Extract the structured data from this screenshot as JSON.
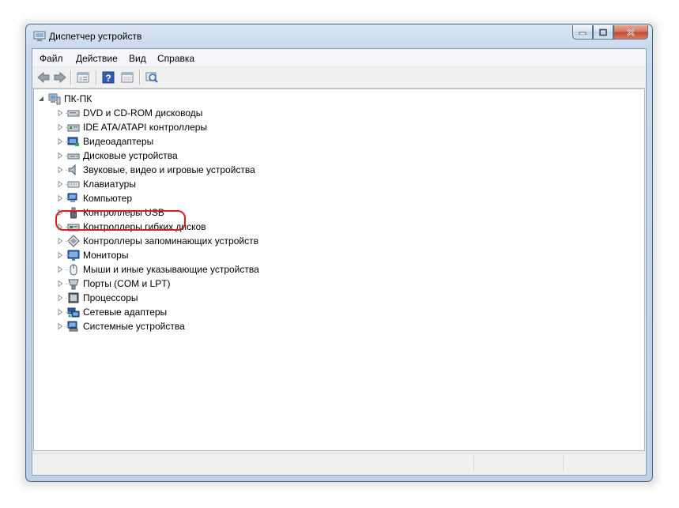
{
  "window": {
    "title": "Диспетчер устройств"
  },
  "menu": {
    "file": "Файл",
    "action": "Действие",
    "view": "Вид",
    "help": "Справка"
  },
  "toolbar": {
    "icons": [
      "back-icon",
      "forward-icon",
      "properties-icon",
      "help-icon",
      "show-hide-icon",
      "scan-hardware-icon"
    ]
  },
  "tree": {
    "root": "ПК-ПК",
    "items": [
      {
        "label": "DVD и CD-ROM дисководы",
        "icon": "dvd-drive-icon"
      },
      {
        "label": "IDE ATA/ATAPI контроллеры",
        "icon": "ide-controller-icon"
      },
      {
        "label": "Видеоадаптеры",
        "icon": "display-adapter-icon"
      },
      {
        "label": "Дисковые устройства",
        "icon": "disk-drive-icon"
      },
      {
        "label": "Звуковые, видео и игровые устройства",
        "icon": "speaker-icon"
      },
      {
        "label": "Клавиатуры",
        "icon": "keyboard-icon"
      },
      {
        "label": "Компьютер",
        "icon": "computer-icon"
      },
      {
        "label": "Контроллеры USB",
        "icon": "usb-icon"
      },
      {
        "label": "Контроллеры гибких дисков",
        "icon": "floppy-controller-icon"
      },
      {
        "label": "Контроллеры запоминающих устройств",
        "icon": "storage-controller-icon"
      },
      {
        "label": "Мониторы",
        "icon": "monitor-icon"
      },
      {
        "label": "Мыши и иные указывающие устройства",
        "icon": "mouse-icon"
      },
      {
        "label": "Порты (COM и LPT)",
        "icon": "port-icon"
      },
      {
        "label": "Процессоры",
        "icon": "processor-icon"
      },
      {
        "label": "Сетевые адаптеры",
        "icon": "network-adapter-icon"
      },
      {
        "label": "Системные устройства",
        "icon": "system-devices-icon"
      }
    ],
    "highlighted": "Контроллеры USB",
    "highlight_color": "#d62020"
  }
}
